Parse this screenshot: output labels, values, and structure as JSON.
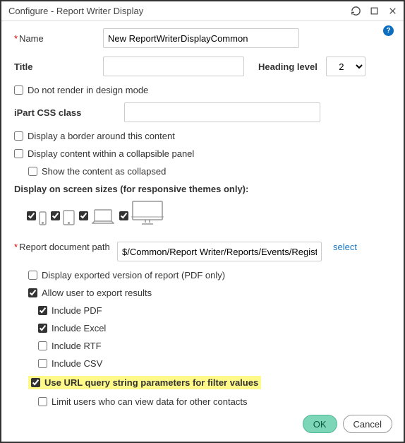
{
  "window": {
    "title": "Configure - Report Writer Display"
  },
  "help": {
    "glyph": "?"
  },
  "fields": {
    "name_label": "Name",
    "name_value": "New ReportWriterDisplayCommon",
    "title_label": "Title",
    "title_value": "",
    "heading_level_label": "Heading level",
    "heading_level_value": "2",
    "css_label": "iPart CSS class",
    "css_value": ""
  },
  "checks": {
    "no_render": "Do not render in design mode",
    "border": "Display a border around this content",
    "collapsible": "Display content within a collapsible panel",
    "show_collapsed": "Show the content as collapsed"
  },
  "responsive_label": "Display on screen sizes (for responsive themes only):",
  "report": {
    "path_label": "Report document path",
    "path_value": "$/Common/Report Writer/Reports/Events/Registration",
    "select_link": "select",
    "export_pdf_only": "Display exported version of report (PDF only)",
    "allow_export": "Allow user to export results",
    "include_pdf": "Include PDF",
    "include_excel": "Include Excel",
    "include_rtf": "Include RTF",
    "include_csv": "Include CSV",
    "use_url_params": "Use URL query string parameters for filter values",
    "limit_users": "Limit users who can view data for other contacts"
  },
  "buttons": {
    "ok": "OK",
    "cancel": "Cancel"
  }
}
